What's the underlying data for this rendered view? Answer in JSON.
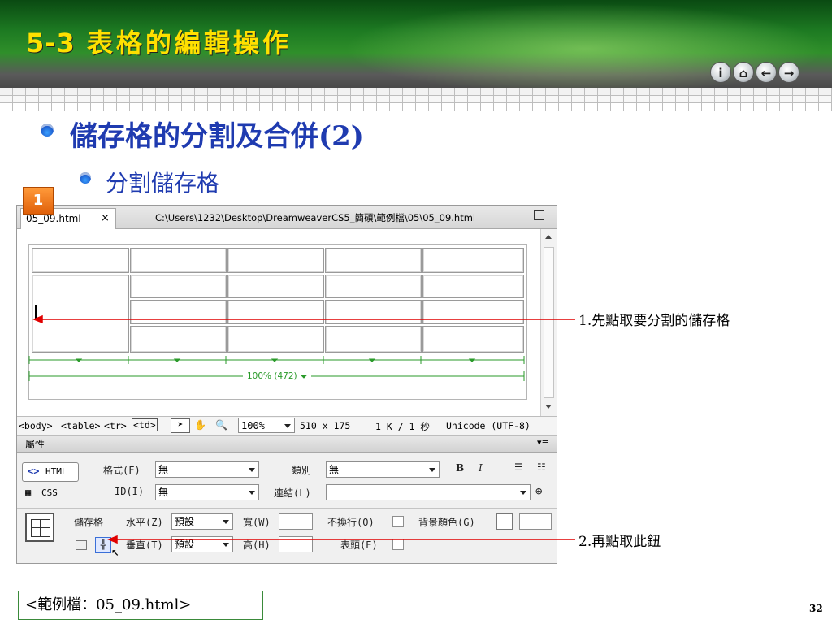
{
  "header": {
    "section_number": "5-3",
    "title": "表格的編輯操作",
    "nav_buttons": [
      {
        "icon": "info-icon",
        "glyph": "i"
      },
      {
        "icon": "home-icon",
        "glyph": "⌂"
      },
      {
        "icon": "back-arrow-icon",
        "glyph": "←"
      },
      {
        "icon": "forward-arrow-icon",
        "glyph": "→"
      }
    ]
  },
  "content": {
    "heading": "儲存格的分割及合併(2)",
    "subheading": "分割儲存格",
    "step_badge": "1"
  },
  "window": {
    "tab_label": "05_09.html",
    "tab_close": "×",
    "file_path": "C:\\Users\\1232\\Desktop\\DreamweaverCS5_簡碩\\範例檔\\05\\05_09.html",
    "table_width_label": "100% (472)",
    "status": {
      "tags": [
        "<body>",
        "<table>",
        "<tr>",
        "<td>"
      ],
      "zoom": "100%",
      "dimensions": "510 x 175",
      "size_time": "1 K / 1 秒",
      "encoding": "Unicode (UTF-8)"
    },
    "properties": {
      "panel_title": "屬性",
      "html_button": "HTML",
      "css_button": "CSS",
      "format_label": "格式(F)",
      "format_value": "無",
      "class_label": "類別",
      "class_value": "無",
      "id_label": "ID(I)",
      "id_value": "無",
      "link_label": "連結(L)",
      "link_value": "",
      "bold_label": "B",
      "italic_label": "I",
      "cell_label": "儲存格",
      "horz_label": "水平(Z)",
      "horz_value": "預設",
      "vert_label": "垂直(T)",
      "vert_value": "預設",
      "width_label": "寬(W)",
      "width_value": "",
      "height_label": "高(H)",
      "height_value": "",
      "nowrap_label": "不換行(O)",
      "header_label": "表頭(E)",
      "bgcolor_label": "背景顏色(G)",
      "bgcolor_value": ""
    }
  },
  "callouts": {
    "first": "1.先點取要分割的儲存格",
    "second": "2.再點取此鈕"
  },
  "footer": {
    "example_file": "<範例檔：05_09.html>",
    "page_number": "32"
  },
  "colors": {
    "title": "#ffe000",
    "heading": "#1f3bb0",
    "callout_line": "#e00000",
    "width_guide": "#2a9a2a"
  }
}
